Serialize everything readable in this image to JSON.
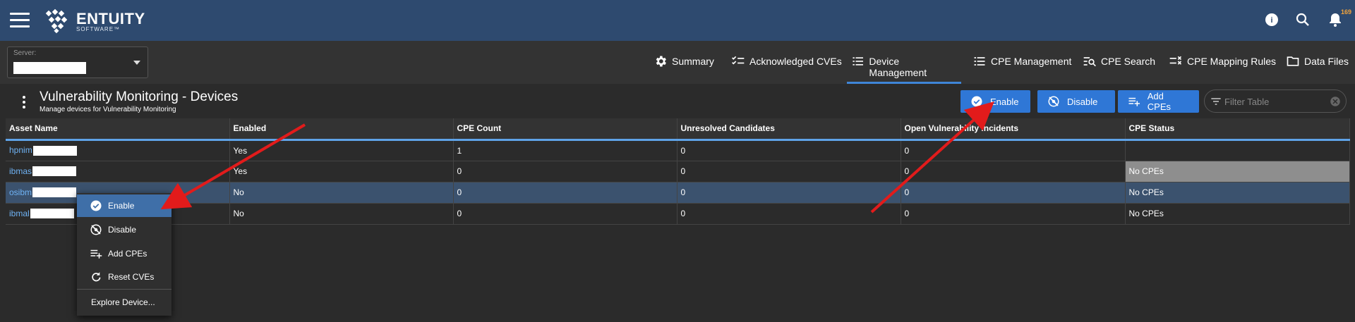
{
  "topbar": {
    "brand": "ENTUITY",
    "brand_sub": "SOFTWARE™",
    "notification_count": "169",
    "icons": [
      "menu-icon",
      "help-icon",
      "search-icon",
      "bell-icon"
    ]
  },
  "server": {
    "label": "Server:"
  },
  "tabs": [
    {
      "label": "Summary",
      "icon": "gear-icon"
    },
    {
      "label": "Acknowledged CVEs",
      "icon": "checklist-icon"
    },
    {
      "label": "Device Management",
      "icon": "list-icon",
      "active": true
    },
    {
      "label": "CPE Management",
      "icon": "list-icon"
    },
    {
      "label": "CPE Search",
      "icon": "list-search-icon"
    },
    {
      "label": "CPE Mapping Rules",
      "icon": "checklist-x-icon"
    },
    {
      "label": "Data Files",
      "icon": "folder-icon"
    }
  ],
  "page": {
    "title": "Vulnerability Monitoring - Devices",
    "subtitle": "Manage devices for Vulnerability Monitoring"
  },
  "actions": {
    "enable": "Enable",
    "disable": "Disable",
    "add_cpes": "Add CPEs",
    "filter_placeholder": "Filter Table"
  },
  "table": {
    "headers": [
      "Asset Name",
      "Enabled",
      "CPE Count",
      "Unresolved Candidates",
      "Open Vulnerability Incidents",
      "CPE Status"
    ],
    "rows": [
      {
        "asset": "hpnim",
        "enabled": "Yes",
        "cpe_count": "1",
        "unresolved": "0",
        "open_incidents": "0",
        "cpe_status": ""
      },
      {
        "asset": "ibmas",
        "enabled": "Yes",
        "cpe_count": "0",
        "unresolved": "0",
        "open_incidents": "0",
        "cpe_status": "No CPEs"
      },
      {
        "asset": "osibm",
        "enabled": "No",
        "cpe_count": "0",
        "unresolved": "0",
        "open_incidents": "0",
        "cpe_status": "No CPEs"
      },
      {
        "asset": "ibmal",
        "enabled": "No",
        "cpe_count": "0",
        "unresolved": "0",
        "open_incidents": "0",
        "cpe_status": "No CPEs"
      }
    ]
  },
  "context_menu": {
    "items": [
      {
        "label": "Enable",
        "icon": "check-circle-icon"
      },
      {
        "label": "Disable",
        "icon": "disabled-eye-icon"
      },
      {
        "label": "Add CPEs",
        "icon": "playlist-add-icon"
      },
      {
        "label": "Reset CVEs",
        "icon": "refresh-icon"
      },
      {
        "label": "Explore Device..."
      }
    ]
  },
  "colors": {
    "topbar": "#2e4a6f",
    "accent": "#2f77d6",
    "annotation_arrow": "#e21b1b"
  }
}
